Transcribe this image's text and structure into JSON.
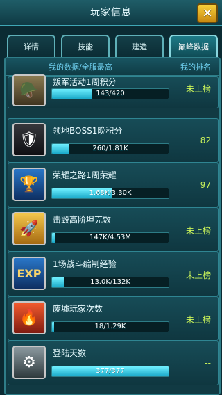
{
  "header": {
    "title": "玩家信息"
  },
  "close_icon": "close-icon",
  "tabs": [
    {
      "label": "详情",
      "active": false
    },
    {
      "label": "技能",
      "active": false
    },
    {
      "label": "建造",
      "active": false
    },
    {
      "label": "巅峰数据",
      "active": true
    }
  ],
  "list_header": {
    "left": "我的数据/全服最高",
    "right": "我的排名"
  },
  "rows": [
    {
      "label": "叛军活动1周积分",
      "value_text": "143/420",
      "progress": 0.34,
      "rank": "未上榜",
      "icon": "soldier-icon"
    },
    {
      "label": "领地BOSS1晚积分",
      "value_text": "260/1.81K",
      "progress": 0.14,
      "rank": "82",
      "icon": "tank-boss-icon"
    },
    {
      "label": "荣耀之路1周荣耀",
      "value_text": "1.68K/3.30K",
      "progress": 0.51,
      "rank": "97",
      "icon": "trophy-icon"
    },
    {
      "label": "击毁高阶坦克数",
      "value_text": "147K/4.53M",
      "progress": 0.03,
      "rank": "未上榜",
      "icon": "missile-icon"
    },
    {
      "label": "1场战斗编制经验",
      "value_text": "13.0K/132K",
      "progress": 0.1,
      "rank": "未上榜",
      "icon": "exp-icon"
    },
    {
      "label": "废墟玩家次数",
      "value_text": "18/1.29K",
      "progress": 0.015,
      "rank": "未上榜",
      "icon": "ruins-icon"
    },
    {
      "label": "登陆天数",
      "value_text": "377/377",
      "progress": 1.0,
      "rank": "--",
      "icon": "login-days-icon"
    }
  ],
  "colors": {
    "accent": "#3fa7b5",
    "rank_green": "#c8f25a",
    "bar_fill": "#43d1e8"
  }
}
